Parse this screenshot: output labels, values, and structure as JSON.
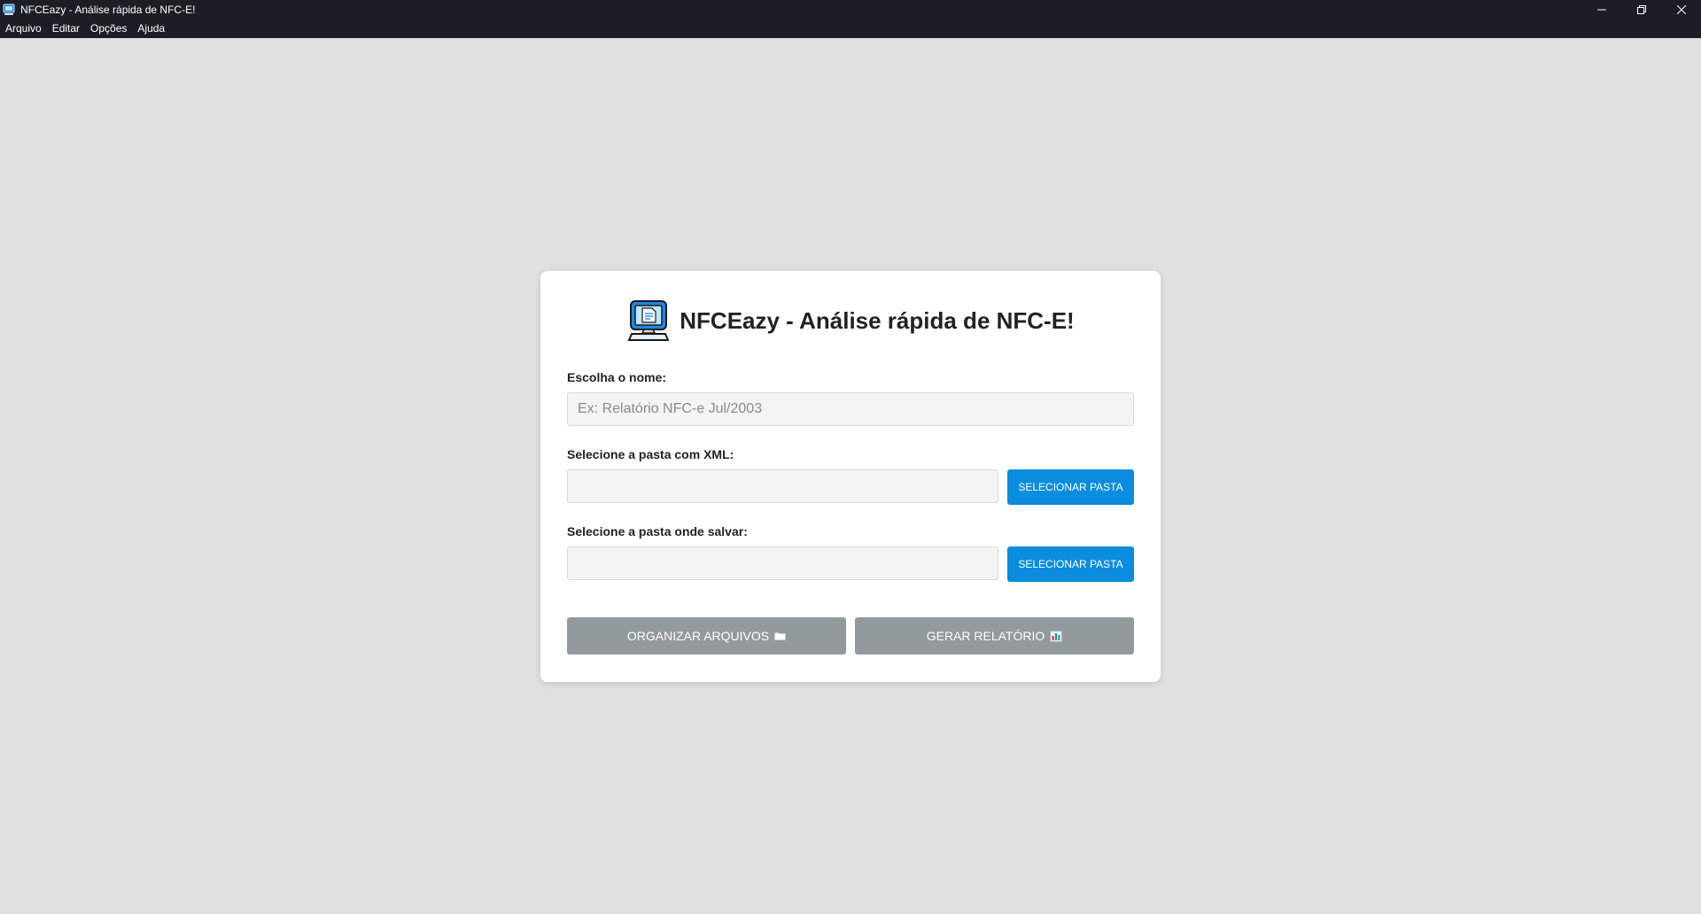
{
  "window": {
    "title": "NFCEazy - Análise rápida de NFC-E!",
    "icon": "computer-icon"
  },
  "menu": [
    "Arquivo",
    "Editar",
    "Opções",
    "Ajuda"
  ],
  "card": {
    "heading": "NFCEazy - Análise rápida de NFC-E!",
    "logo_icon": "computer-document-icon",
    "name_label": "Escolha o nome:",
    "name_value": "",
    "name_placeholder": "Ex: Relatório NFC-e Jul/2003",
    "xml_label": "Selecione a pasta com XML:",
    "xml_value": "",
    "xml_button": "SELECIONAR PASTA",
    "save_label": "Selecione a pasta onde salvar:",
    "save_value": "",
    "save_button": "SELECIONAR PASTA",
    "organize_button": "ORGANIZAR ARQUIVOS",
    "organize_icon": "folder-icon",
    "report_button": "GERAR RELATÓRIO",
    "report_icon": "bar-chart-icon"
  },
  "colors": {
    "accent": "#0a8ddf",
    "disabled_button": "#929a9d",
    "titlebar": "#1b1f25",
    "background": "#e0e0e0"
  }
}
